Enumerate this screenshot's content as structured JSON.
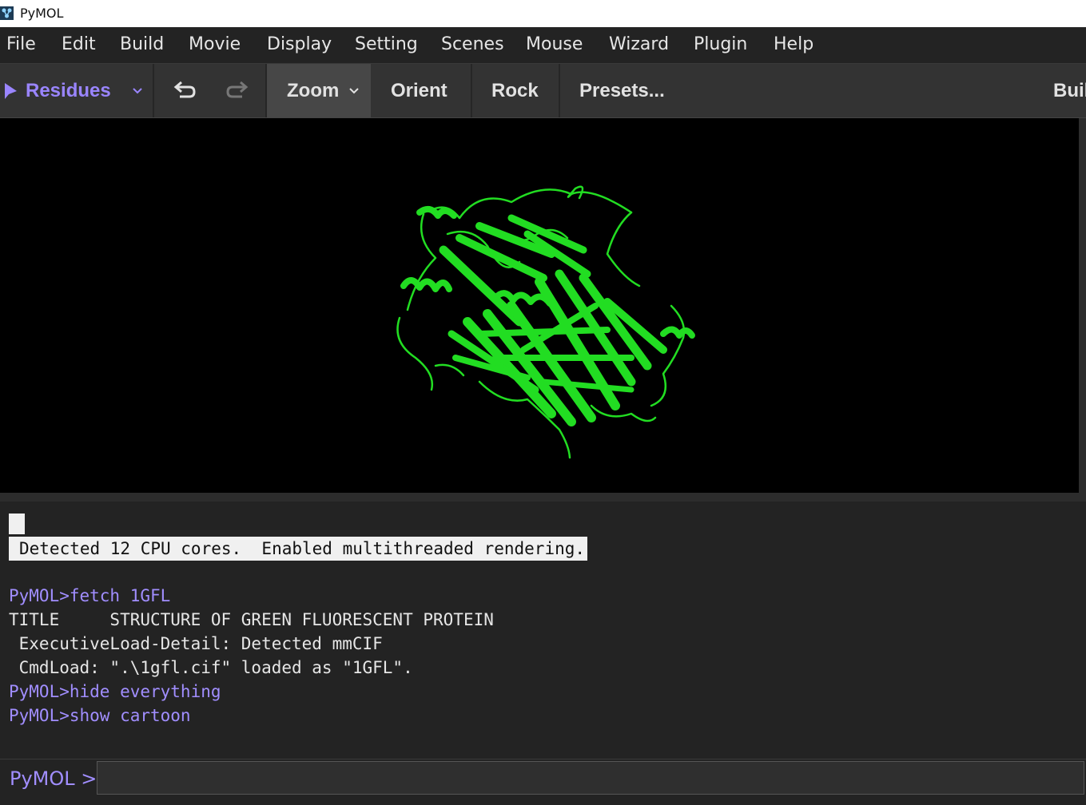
{
  "window": {
    "title": "PyMOL"
  },
  "menu": [
    "File",
    "Edit",
    "Build",
    "Movie",
    "Display",
    "Setting",
    "Scenes",
    "Mouse",
    "Wizard",
    "Plugin",
    "Help"
  ],
  "toolbar": {
    "mode_label": "Residues",
    "zoom_label": "Zoom",
    "orient_label": "Orient",
    "rock_label": "Rock",
    "presets_label": "Presets...",
    "build_label": "Buil"
  },
  "viewport": {
    "structure_color": "#22dd22",
    "background": "#000000"
  },
  "console": {
    "notice": "Detected 12 CPU cores.  Enabled multithreaded rendering.",
    "lines": [
      {
        "kind": "cmd",
        "text": "PyMOL>fetch 1GFL"
      },
      {
        "kind": "out",
        "text": "TITLE     STRUCTURE OF GREEN FLUORESCENT PROTEIN"
      },
      {
        "kind": "out",
        "text": " ExecutiveLoad-Detail: Detected mmCIF"
      },
      {
        "kind": "out",
        "text": " CmdLoad: \".\\1gfl.cif\" loaded as \"1GFL\"."
      },
      {
        "kind": "cmd",
        "text": "PyMOL>hide everything"
      },
      {
        "kind": "cmd",
        "text": "PyMOL>show cartoon"
      }
    ]
  },
  "command": {
    "prompt": "PyMOL >",
    "value": ""
  },
  "colors": {
    "accent": "#a18eff",
    "protein": "#22dd22"
  }
}
